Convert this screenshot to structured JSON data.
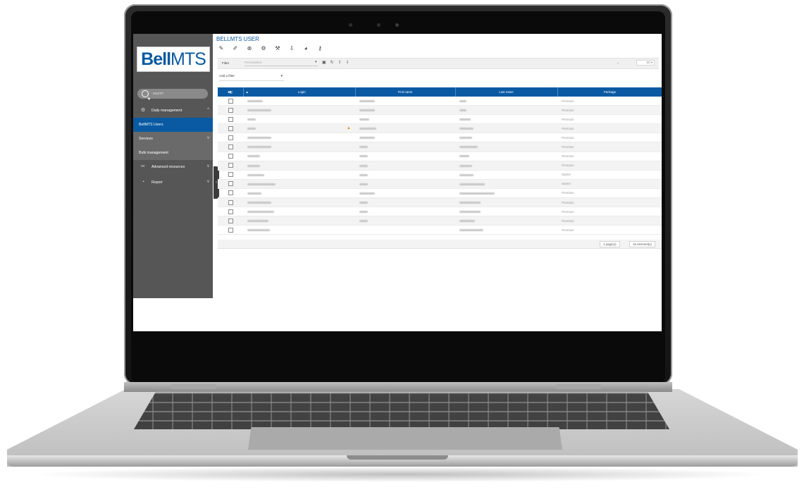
{
  "app": {
    "logo_bold": "Bell",
    "logo_light": "MTS",
    "title": "BELLMTS USER"
  },
  "colors": {
    "accent": "#0a5aa3",
    "sidebar": "#565656",
    "warning": "#f08a1a"
  },
  "toolbar": {
    "icons": [
      "magic-wand-icon",
      "edit-icon",
      "delete-icon",
      "settings-icon",
      "tools-icon",
      "export-icon",
      "stats-icon",
      "key-icon"
    ]
  },
  "filter": {
    "label": "Filter",
    "placeholder": "Personalized",
    "icons": [
      "save-icon",
      "reload-icon",
      "import-icon",
      "export-icon"
    ],
    "page_size": "50"
  },
  "add_filter": {
    "label": "Add a filter"
  },
  "sidebar": {
    "search_placeholder": "search",
    "items": [
      {
        "label": "Daily management",
        "icon": "gear-icon",
        "expanded": true
      },
      {
        "label": "BellMTS Users",
        "active": true
      },
      {
        "label": "Services"
      },
      {
        "label": "Bulk management"
      },
      {
        "label": "Advanced resources",
        "icon": "tools-icon"
      },
      {
        "label": "Report",
        "icon": "pie-icon"
      }
    ]
  },
  "table": {
    "columns": [
      "Login",
      "First name",
      "Last name",
      "Package"
    ],
    "rows": [
      {
        "login_w": 22,
        "first_w": 22,
        "last_w": 10,
        "package": "Premium"
      },
      {
        "login_w": 34,
        "first_w": 22,
        "last_w": 10,
        "package": "Premium"
      },
      {
        "login_w": 12,
        "first_w": 14,
        "last_w": 16,
        "package": "Premium"
      },
      {
        "login_w": 12,
        "first_w": 24,
        "last_w": 20,
        "package": "Premium",
        "warning": true
      },
      {
        "login_w": 34,
        "first_w": 22,
        "last_w": 18,
        "package": "Premium"
      },
      {
        "login_w": 34,
        "first_w": 12,
        "last_w": 26,
        "package": "Premium"
      },
      {
        "login_w": 18,
        "first_w": 12,
        "last_w": 14,
        "package": "Premium"
      },
      {
        "login_w": 18,
        "first_w": 12,
        "last_w": 18,
        "package": "Premium"
      },
      {
        "login_w": 24,
        "first_w": 12,
        "last_w": 20,
        "package": "Starter"
      },
      {
        "login_w": 40,
        "first_w": 12,
        "last_w": 36,
        "package": "Starter"
      },
      {
        "login_w": 20,
        "first_w": 22,
        "last_w": 50,
        "package": "Premium"
      },
      {
        "login_w": 34,
        "first_w": 12,
        "last_w": 30,
        "package": "Premium"
      },
      {
        "login_w": 38,
        "first_w": 12,
        "last_w": 30,
        "package": "Premium"
      },
      {
        "login_w": 30,
        "first_w": 12,
        "last_w": 22,
        "package": "Premium"
      },
      {
        "login_w": 32,
        "first_w": 0,
        "last_w": 34,
        "package": "Premium"
      }
    ]
  },
  "footer": {
    "page": "1 page(s)",
    "count": "15 element(s)"
  }
}
